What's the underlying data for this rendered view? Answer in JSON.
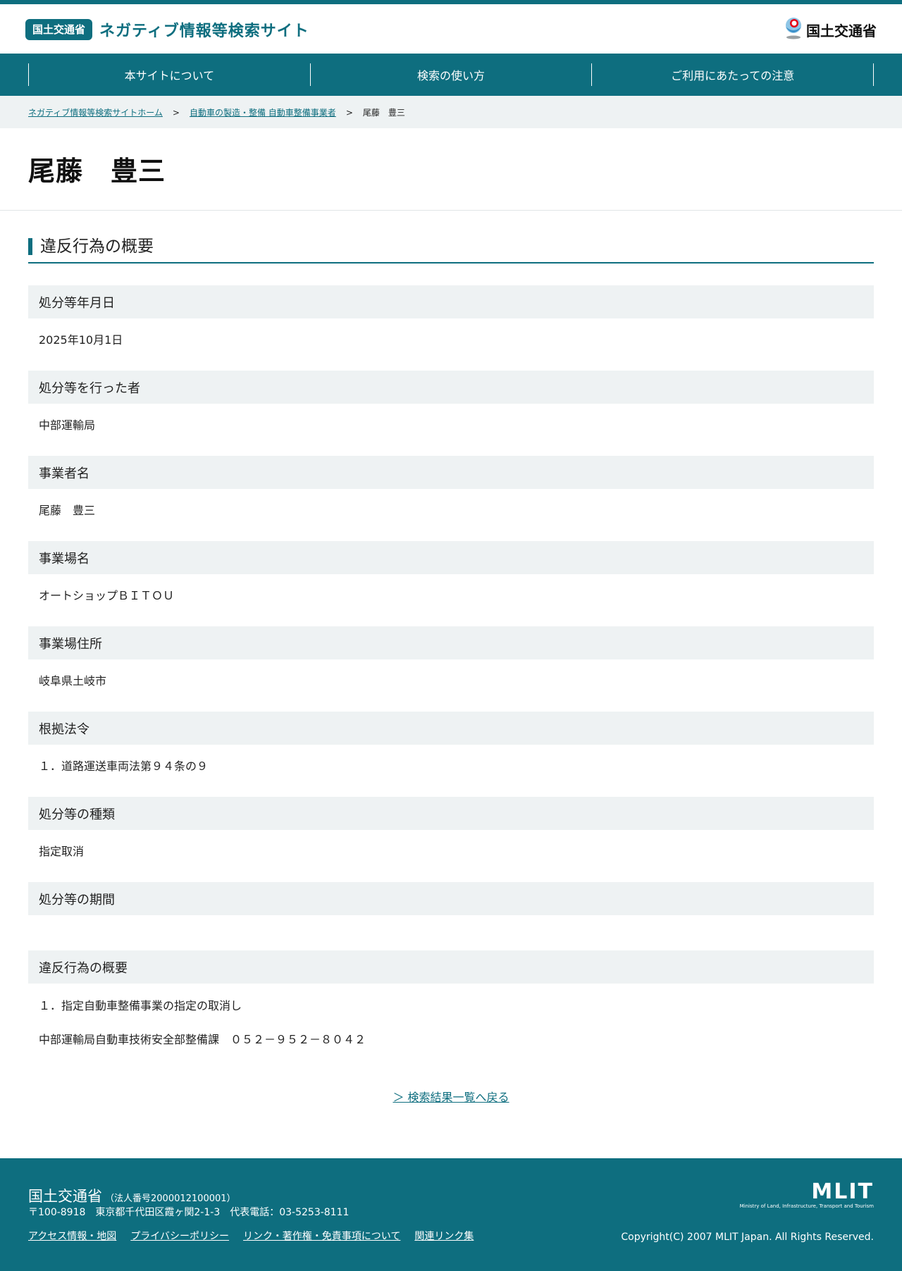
{
  "header": {
    "badge": "国土交通省",
    "site_title": "ネガティブ情報等検索サイト",
    "ministry_logo_text": "国土交通省",
    "logo_icon": "mlit-emblem-icon"
  },
  "nav": {
    "items": [
      {
        "label": "本サイトについて"
      },
      {
        "label": "検索の使い方"
      },
      {
        "label": "ご利用にあたっての注意"
      }
    ]
  },
  "breadcrumb": {
    "home": "ネガティブ情報等検索サイトホーム",
    "category": "自動車の製造・整備 自動車整備事業者",
    "current": "尾藤　豊三",
    "separator": ">"
  },
  "page_title": "尾藤　豊三",
  "section_title": "違反行為の概要",
  "fields": [
    {
      "label": "処分等年月日",
      "values": [
        "2025年10月1日"
      ]
    },
    {
      "label": "処分等を行った者",
      "values": [
        "中部運輸局"
      ]
    },
    {
      "label": "事業者名",
      "values": [
        "尾藤　豊三"
      ]
    },
    {
      "label": "事業場名",
      "values": [
        "オートショップＢＩＴＯＵ"
      ]
    },
    {
      "label": "事業場住所",
      "values": [
        "岐阜県土岐市"
      ]
    },
    {
      "label": "根拠法令",
      "values": [
        "１．道路運送車両法第９４条の９"
      ]
    },
    {
      "label": "処分等の種類",
      "values": [
        "指定取消"
      ]
    },
    {
      "label": "処分等の期間",
      "values": []
    },
    {
      "label": "違反行為の概要",
      "values": [
        "１．指定自動車整備事業の指定の取消し",
        "中部運輸局自動車技術安全部整備課　０５２－９５２－８０４２"
      ]
    }
  ],
  "back_link": "＞ 検索結果一覧へ戻る",
  "footer": {
    "org": "国土交通省",
    "corp_number": "（法人番号2000012100001）",
    "address": "〒100-8918　東京都千代田区霞ヶ関2-1-3　代表電話：03-5253-8111",
    "links": [
      "アクセス情報・地図",
      "プライバシーポリシー",
      "リンク・著作権・免責事項について",
      "関連リンク集"
    ],
    "logo_main": "MLIT",
    "logo_sub": "Ministry of Land, Infrastructure, Transport and Tourism",
    "copyright": "Copyright(C) 2007 MLIT Japan. All Rights Reserved."
  },
  "colors": {
    "brand": "#0e6e7f",
    "label_bg": "#eef2f3"
  }
}
